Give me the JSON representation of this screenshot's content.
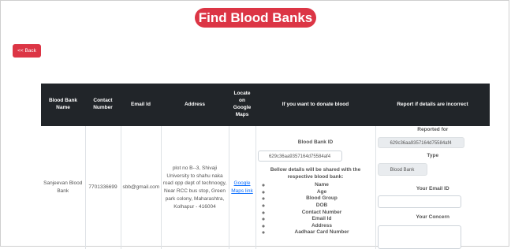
{
  "page": {
    "title": "Find Blood Banks",
    "back_label": "<< Back"
  },
  "table": {
    "headers": {
      "name": "Blood Bank Name",
      "contact": "Contact Number",
      "email": "Email Id",
      "address": "Address",
      "locate": "Locate on Google Maps",
      "donate": "If you want to donate blood",
      "report": "Report if details are incorrect"
    },
    "rows": [
      {
        "name": "Sanjeevan Blood Bank",
        "contact": "7701336699",
        "email": "sbb@gmail.com",
        "address": "plot no B--3, Shivaji University to shahu naka road opp dept of technoogy, Near RCC bus stop, Green park colony, Maharashtra, Kolhapur - 416004",
        "map_link": "Google Maps link",
        "donate": {
          "id_label": "Blood Bank ID",
          "id_value": "629c36aa9357164d75584af4",
          "note": "Bellow details will be shared with the respective blood bank:",
          "items": [
            "Name",
            "Age",
            "Blood Group",
            "DOB",
            "Contact Number",
            "Email Id",
            "Address",
            "Aadhaar Card Number"
          ]
        },
        "report": {
          "reported_for_label": "Reported for",
          "reported_for_value": "629c36aa9357164d75584af4",
          "type_label": "Type",
          "type_value": "Blood Bank",
          "email_label": "Your Email ID",
          "email_value": "",
          "concern_label": "Your Concern",
          "concern_value": ""
        }
      }
    ]
  },
  "colors": {
    "accent": "#dc3545",
    "header_bg": "#212529",
    "link": "#0d6efd"
  }
}
